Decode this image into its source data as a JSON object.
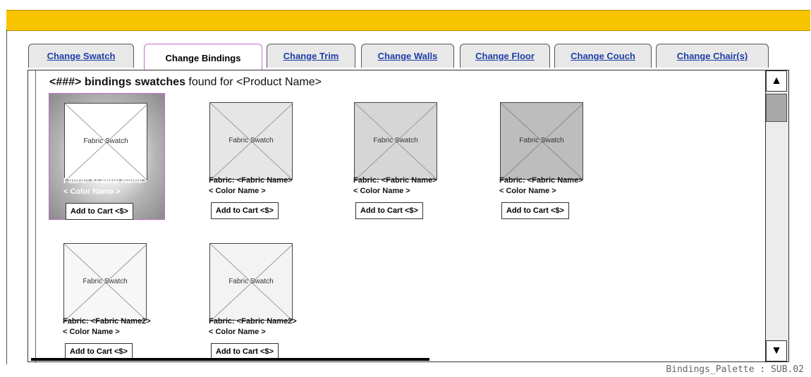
{
  "tabs": [
    {
      "label": "Change Swatch",
      "active": false
    },
    {
      "label": "Change Bindings",
      "active": true
    },
    {
      "label": "Change Trim",
      "active": false
    },
    {
      "label": "Change Walls",
      "active": false
    },
    {
      "label": "Change Floor",
      "active": false
    },
    {
      "label": "Change Couch",
      "active": false
    },
    {
      "label": "Change Chair(s)",
      "active": false
    }
  ],
  "heading": {
    "bold": "<###> bindings swatches",
    "rest": " found for <Product Name>"
  },
  "swatches": [
    {
      "image_label": "Fabric Swatch",
      "fabric": "Fabric: <Fabric Name>",
      "color": "< Color Name >",
      "cart": "Add to Cart <$>",
      "shade": "#ffffff",
      "selected": true
    },
    {
      "image_label": "Fabric Swatch",
      "fabric": "Fabric: <Fabric Name>",
      "color": "< Color  Name >",
      "cart": "Add to Cart <$>",
      "shade": "#e6e6e6",
      "selected": false
    },
    {
      "image_label": "Fabric Swatch",
      "fabric": "Fabric: <Fabric Name>",
      "color": "< Color Name >",
      "cart": "Add to Cart <$>",
      "shade": "#d6d6d6",
      "selected": false
    },
    {
      "image_label": "Fabric Swatch",
      "fabric": "Fabric: <Fabric Name>",
      "color": "< Color Name >",
      "cart": "Add to Cart <$>",
      "shade": "#bdbdbd",
      "selected": false
    },
    {
      "image_label": "Fabric Swatch",
      "fabric": "Fabric: <Fabric Name2>",
      "color": "< Color Name >",
      "cart": "Add to Cart <$>",
      "shade": "#f7f7f7",
      "selected": false
    },
    {
      "image_label": "Fabric Swatch",
      "fabric": "Fabric: <Fabric Name2>",
      "color": "< Color Name >",
      "cart": "Add to Cart <$>",
      "shade": "#f3f3f3",
      "selected": false
    }
  ],
  "scrollbar": {
    "up_icon": "arrow-up-icon",
    "down_icon": "arrow-down-icon"
  },
  "footer": "Bindings_Palette : SUB.02",
  "colors": {
    "topbar": "#f8c400",
    "selection": "#c66bd0",
    "link": "#1f3fa5"
  }
}
